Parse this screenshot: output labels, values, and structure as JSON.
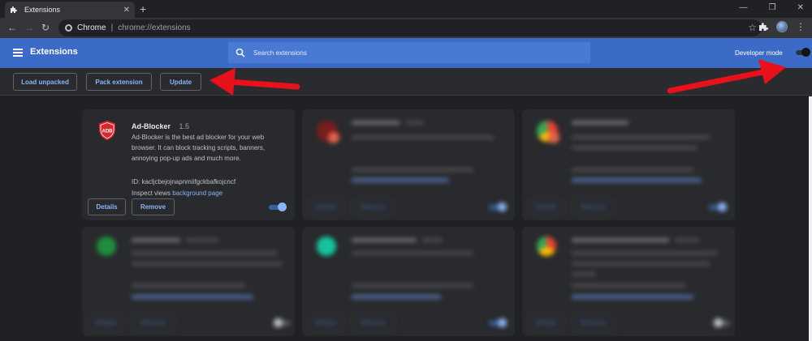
{
  "browser": {
    "tab_title": "Extensions",
    "new_tab_symbol": "+",
    "omnibox_chrome": "Chrome",
    "omnibox_sep": "|",
    "omnibox_url": "chrome://extensions"
  },
  "header": {
    "title": "Extensions",
    "search_placeholder": "Search extensions",
    "developer_mode_label": "Developer mode",
    "developer_mode_on": true
  },
  "dev_toolbar": {
    "load_unpacked": "Load unpacked",
    "pack_extension": "Pack extension",
    "update": "Update"
  },
  "featured_card": {
    "name": "Ad-Blocker",
    "version": "1.5",
    "description": "Ad-Blocker is the best ad blocker for your web browser. It can block tracking scripts, banners, annoying pop-up ads and much more.",
    "id_text": "ID: kacljcbejojnapnmiifgckbafkojcncf",
    "inspect_prefix": "Inspect views",
    "inspect_link": "background page",
    "details_label": "Details",
    "remove_label": "Remove",
    "enabled": true,
    "icon_text": "ADB"
  },
  "blurred_card_labels": {
    "details": "Details",
    "remove": "Remove"
  },
  "colors": {
    "header_blue": "#3c6bc7",
    "link_blue": "#8ab4f8",
    "arrow_red": "#e8101a"
  }
}
